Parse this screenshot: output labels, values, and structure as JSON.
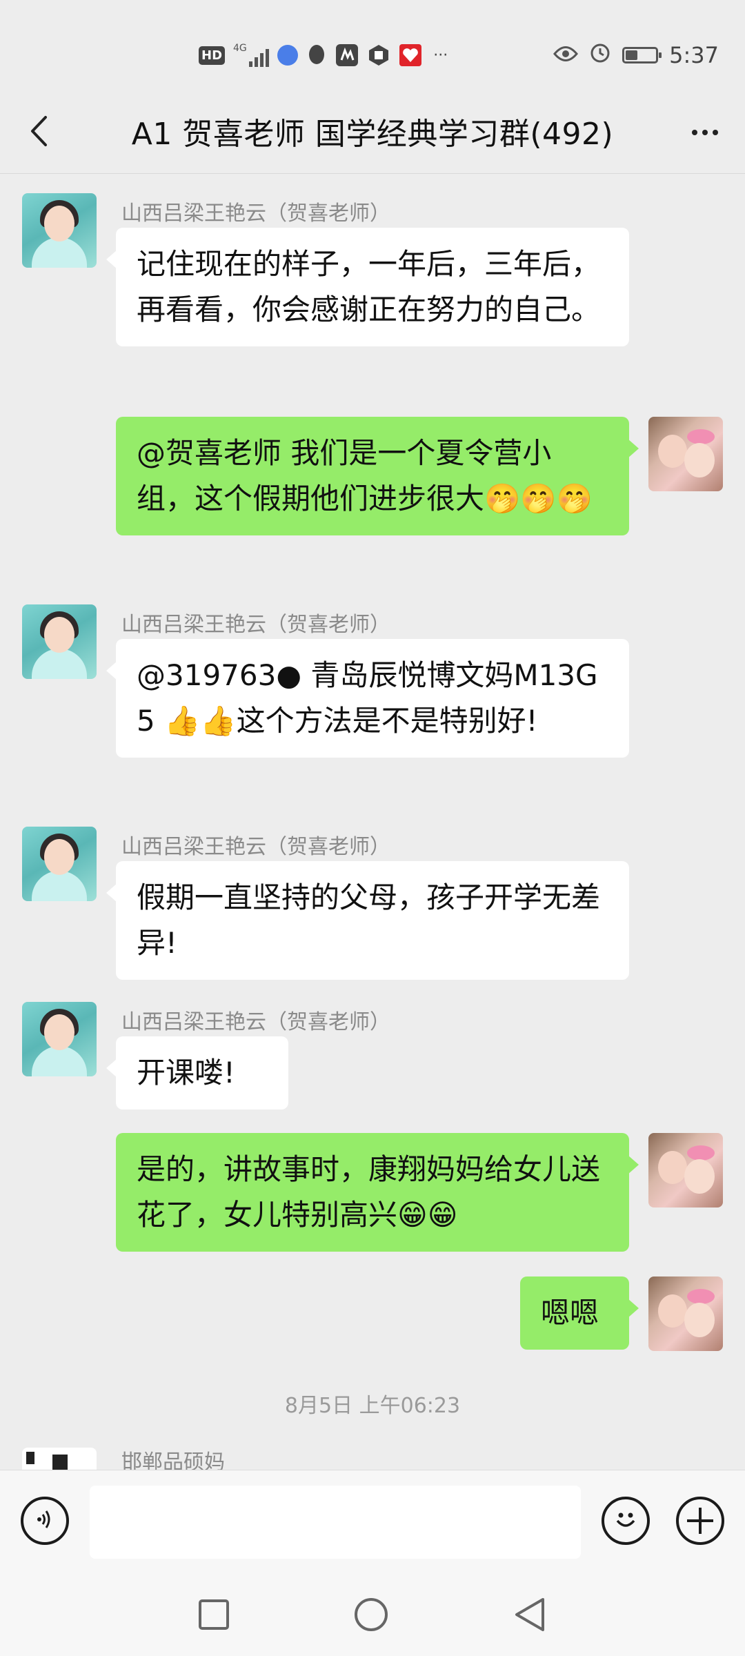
{
  "status_bar": {
    "icons": [
      "hd-icon",
      "4g-signal-icon",
      "music-app-icon",
      "qq-icon",
      "app-icon",
      "app-icon",
      "app-icon",
      "more-dots"
    ],
    "hd_label": "HD",
    "network_label": "4G",
    "more_label": "···",
    "right_icons": [
      "eye-icon",
      "alarm-icon",
      "battery-icon"
    ],
    "battery_level": 0.4,
    "time": "5:37"
  },
  "header": {
    "title": "A1 贺喜老师 国学经典学习群(492)",
    "back_icon": "chevron-left-icon",
    "more_icon": "more-horizontal-icon"
  },
  "messages": [
    {
      "side": "in",
      "sender": "山西吕梁王艳云（贺喜老师）",
      "text": "记住现在的样子，一年后，三年后，再看看，你会感谢正在努力的自己。"
    },
    {
      "side": "out",
      "text": "@贺喜老师  我们是一个夏令营小组，这个假期他们进步很大🤭🤭🤭"
    },
    {
      "side": "in",
      "sender": "山西吕梁王艳云（贺喜老师）",
      "text": "@319763● 青岛辰悦博文妈M13G5 👍👍这个方法是不是特别好!"
    },
    {
      "side": "in",
      "sender": "山西吕梁王艳云（贺喜老师）",
      "text": "假期一直坚持的父母，孩子开学无差异!"
    },
    {
      "side": "in",
      "sender": "山西吕梁王艳云（贺喜老师）",
      "text": "开课喽!"
    },
    {
      "side": "out",
      "text": "是的，讲故事时，康翔妈妈给女儿送花了，女儿特别高兴😁😁"
    },
    {
      "side": "out",
      "text": "嗯嗯"
    },
    {
      "type": "timestamp",
      "text": "8月5日 上午06:23"
    },
    {
      "side": "in",
      "sender": "邯郸品硕妈"
    }
  ],
  "input_bar": {
    "voice_icon": "voice-icon",
    "input_value": "",
    "emoji_icon": "emoji-icon",
    "plus_icon": "plus-icon"
  },
  "nav_bar": {
    "icons": [
      "recent-apps-icon",
      "home-icon",
      "back-icon"
    ]
  }
}
